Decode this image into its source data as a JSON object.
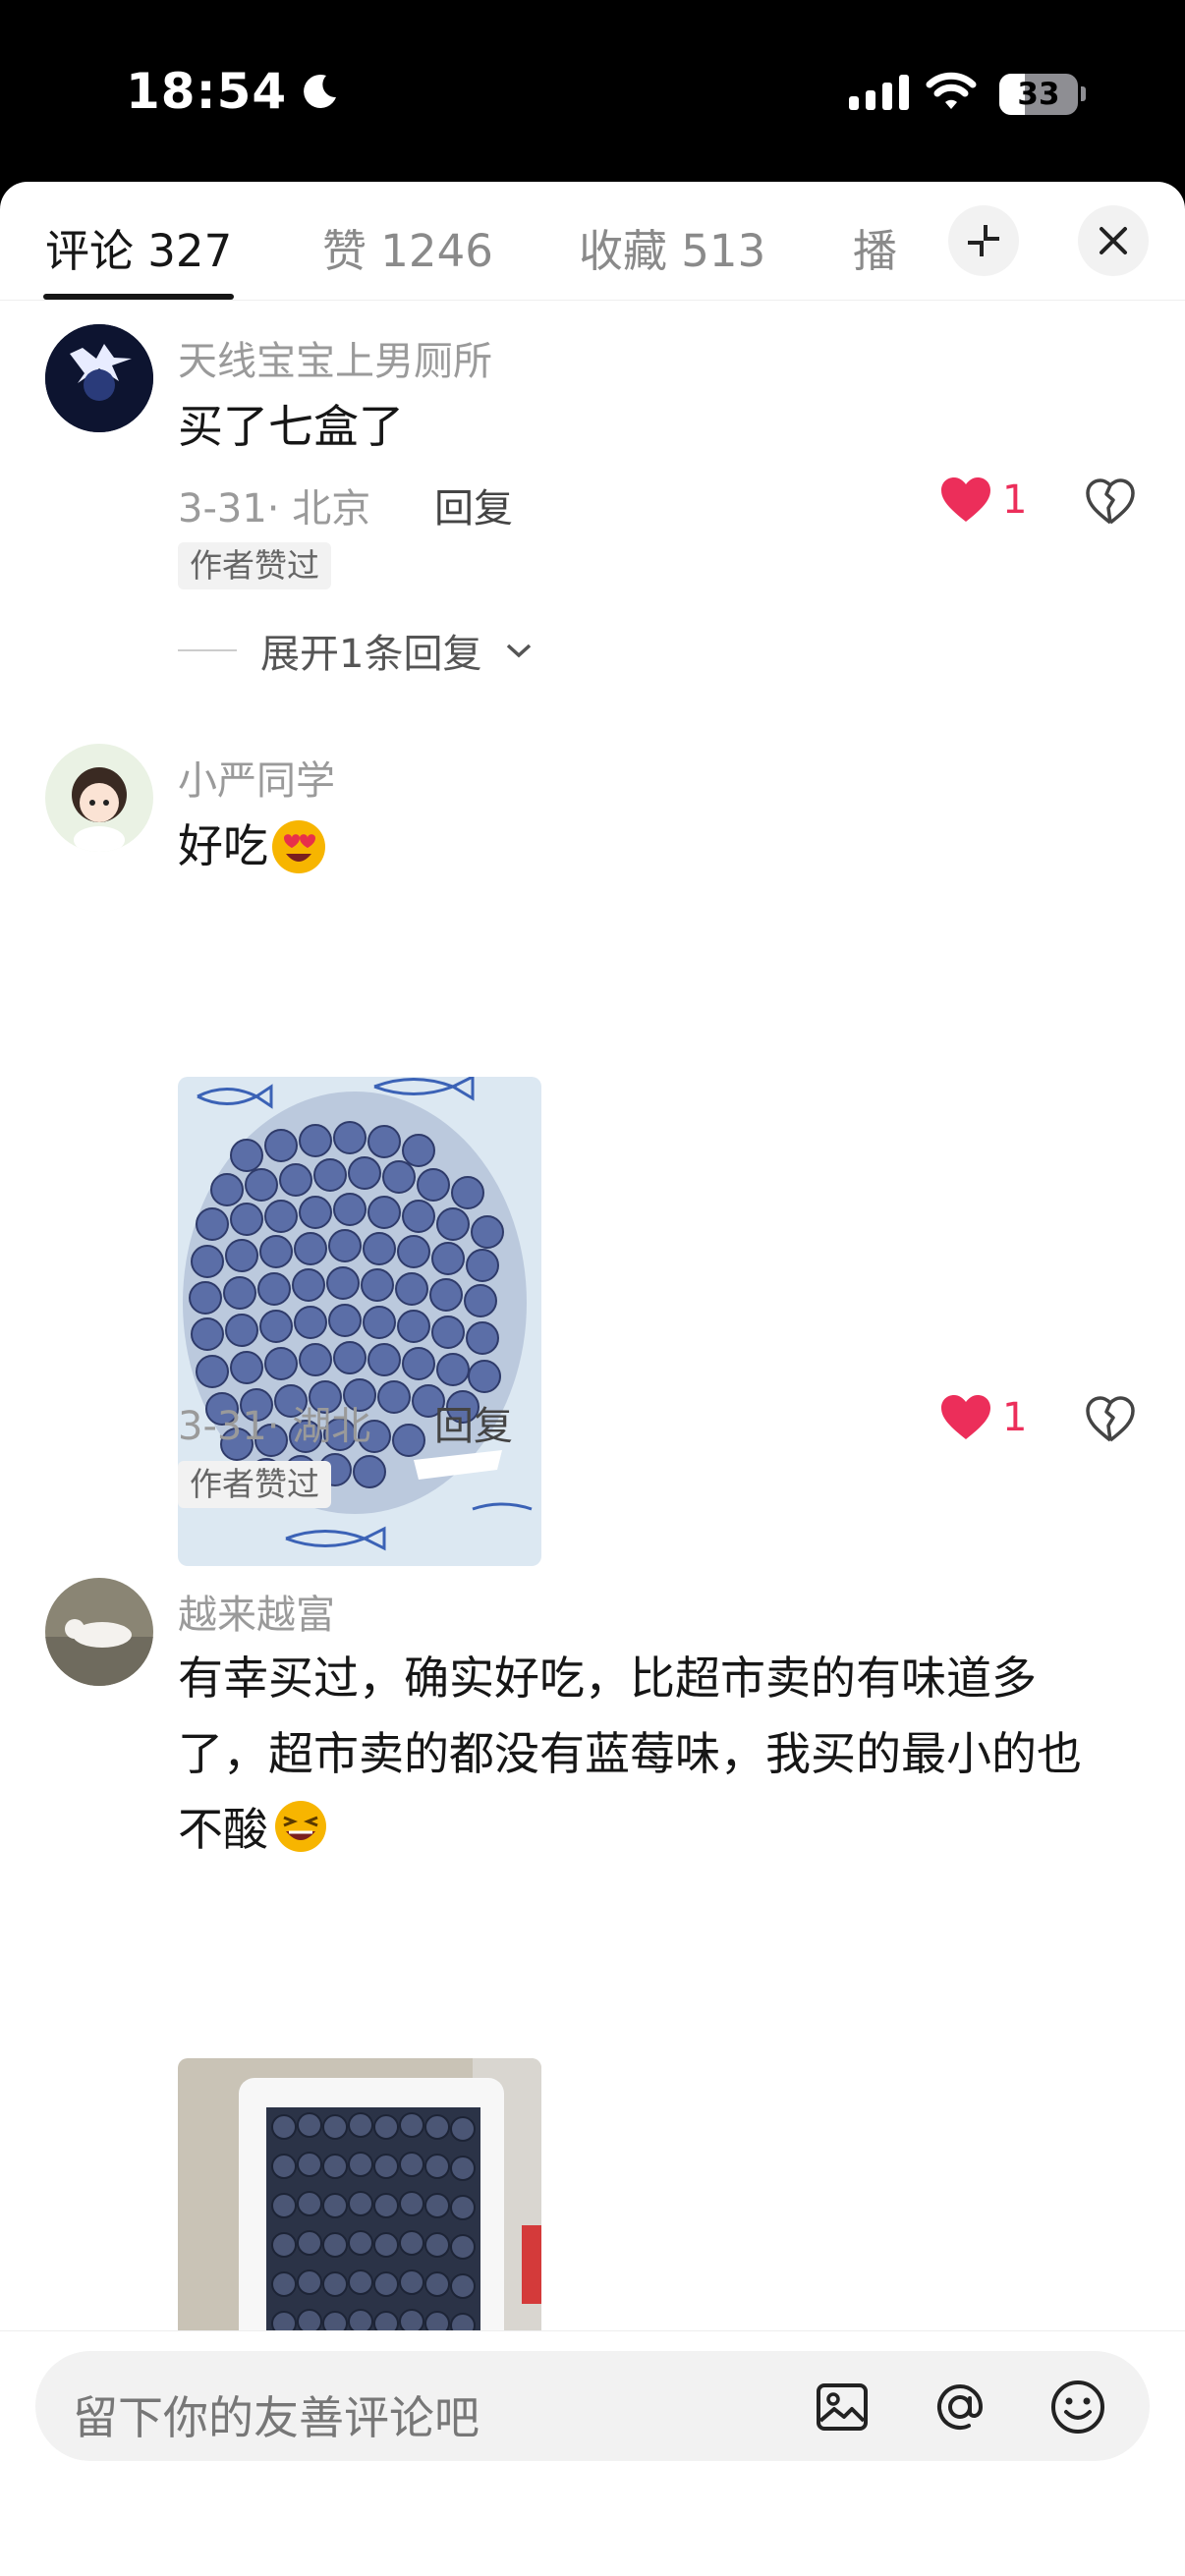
{
  "status_bar": {
    "time": "18:54",
    "battery": "33"
  },
  "tabs": [
    {
      "label": "评论 327",
      "active": true
    },
    {
      "label": "赞 1246",
      "active": false
    },
    {
      "label": "收藏 513",
      "active": false
    },
    {
      "label": "播",
      "active": false
    }
  ],
  "comments": [
    {
      "username": "天线宝宝上男厕所",
      "text": "买了七盒了",
      "date_location": "3-31· 北京",
      "reply_label": "回复",
      "like_count": "1",
      "badge": "作者赞过",
      "expand_replies": "展开1条回复"
    },
    {
      "username": "小严同学",
      "text": "好吃",
      "date_location": "3-31· 湖北",
      "reply_label": "回复",
      "like_count": "1",
      "badge": "作者赞过"
    },
    {
      "username": "越来越富",
      "text": "有幸买过，确实好吃，比超市卖的有味道多了，超市卖的都没有蓝莓味，我买的最小的也不酸"
    }
  ],
  "input": {
    "placeholder": "留下你的友善评论吧"
  },
  "colors": {
    "like": "#ec2e5a",
    "text": "#161616",
    "muted": "#9a9a9a"
  }
}
